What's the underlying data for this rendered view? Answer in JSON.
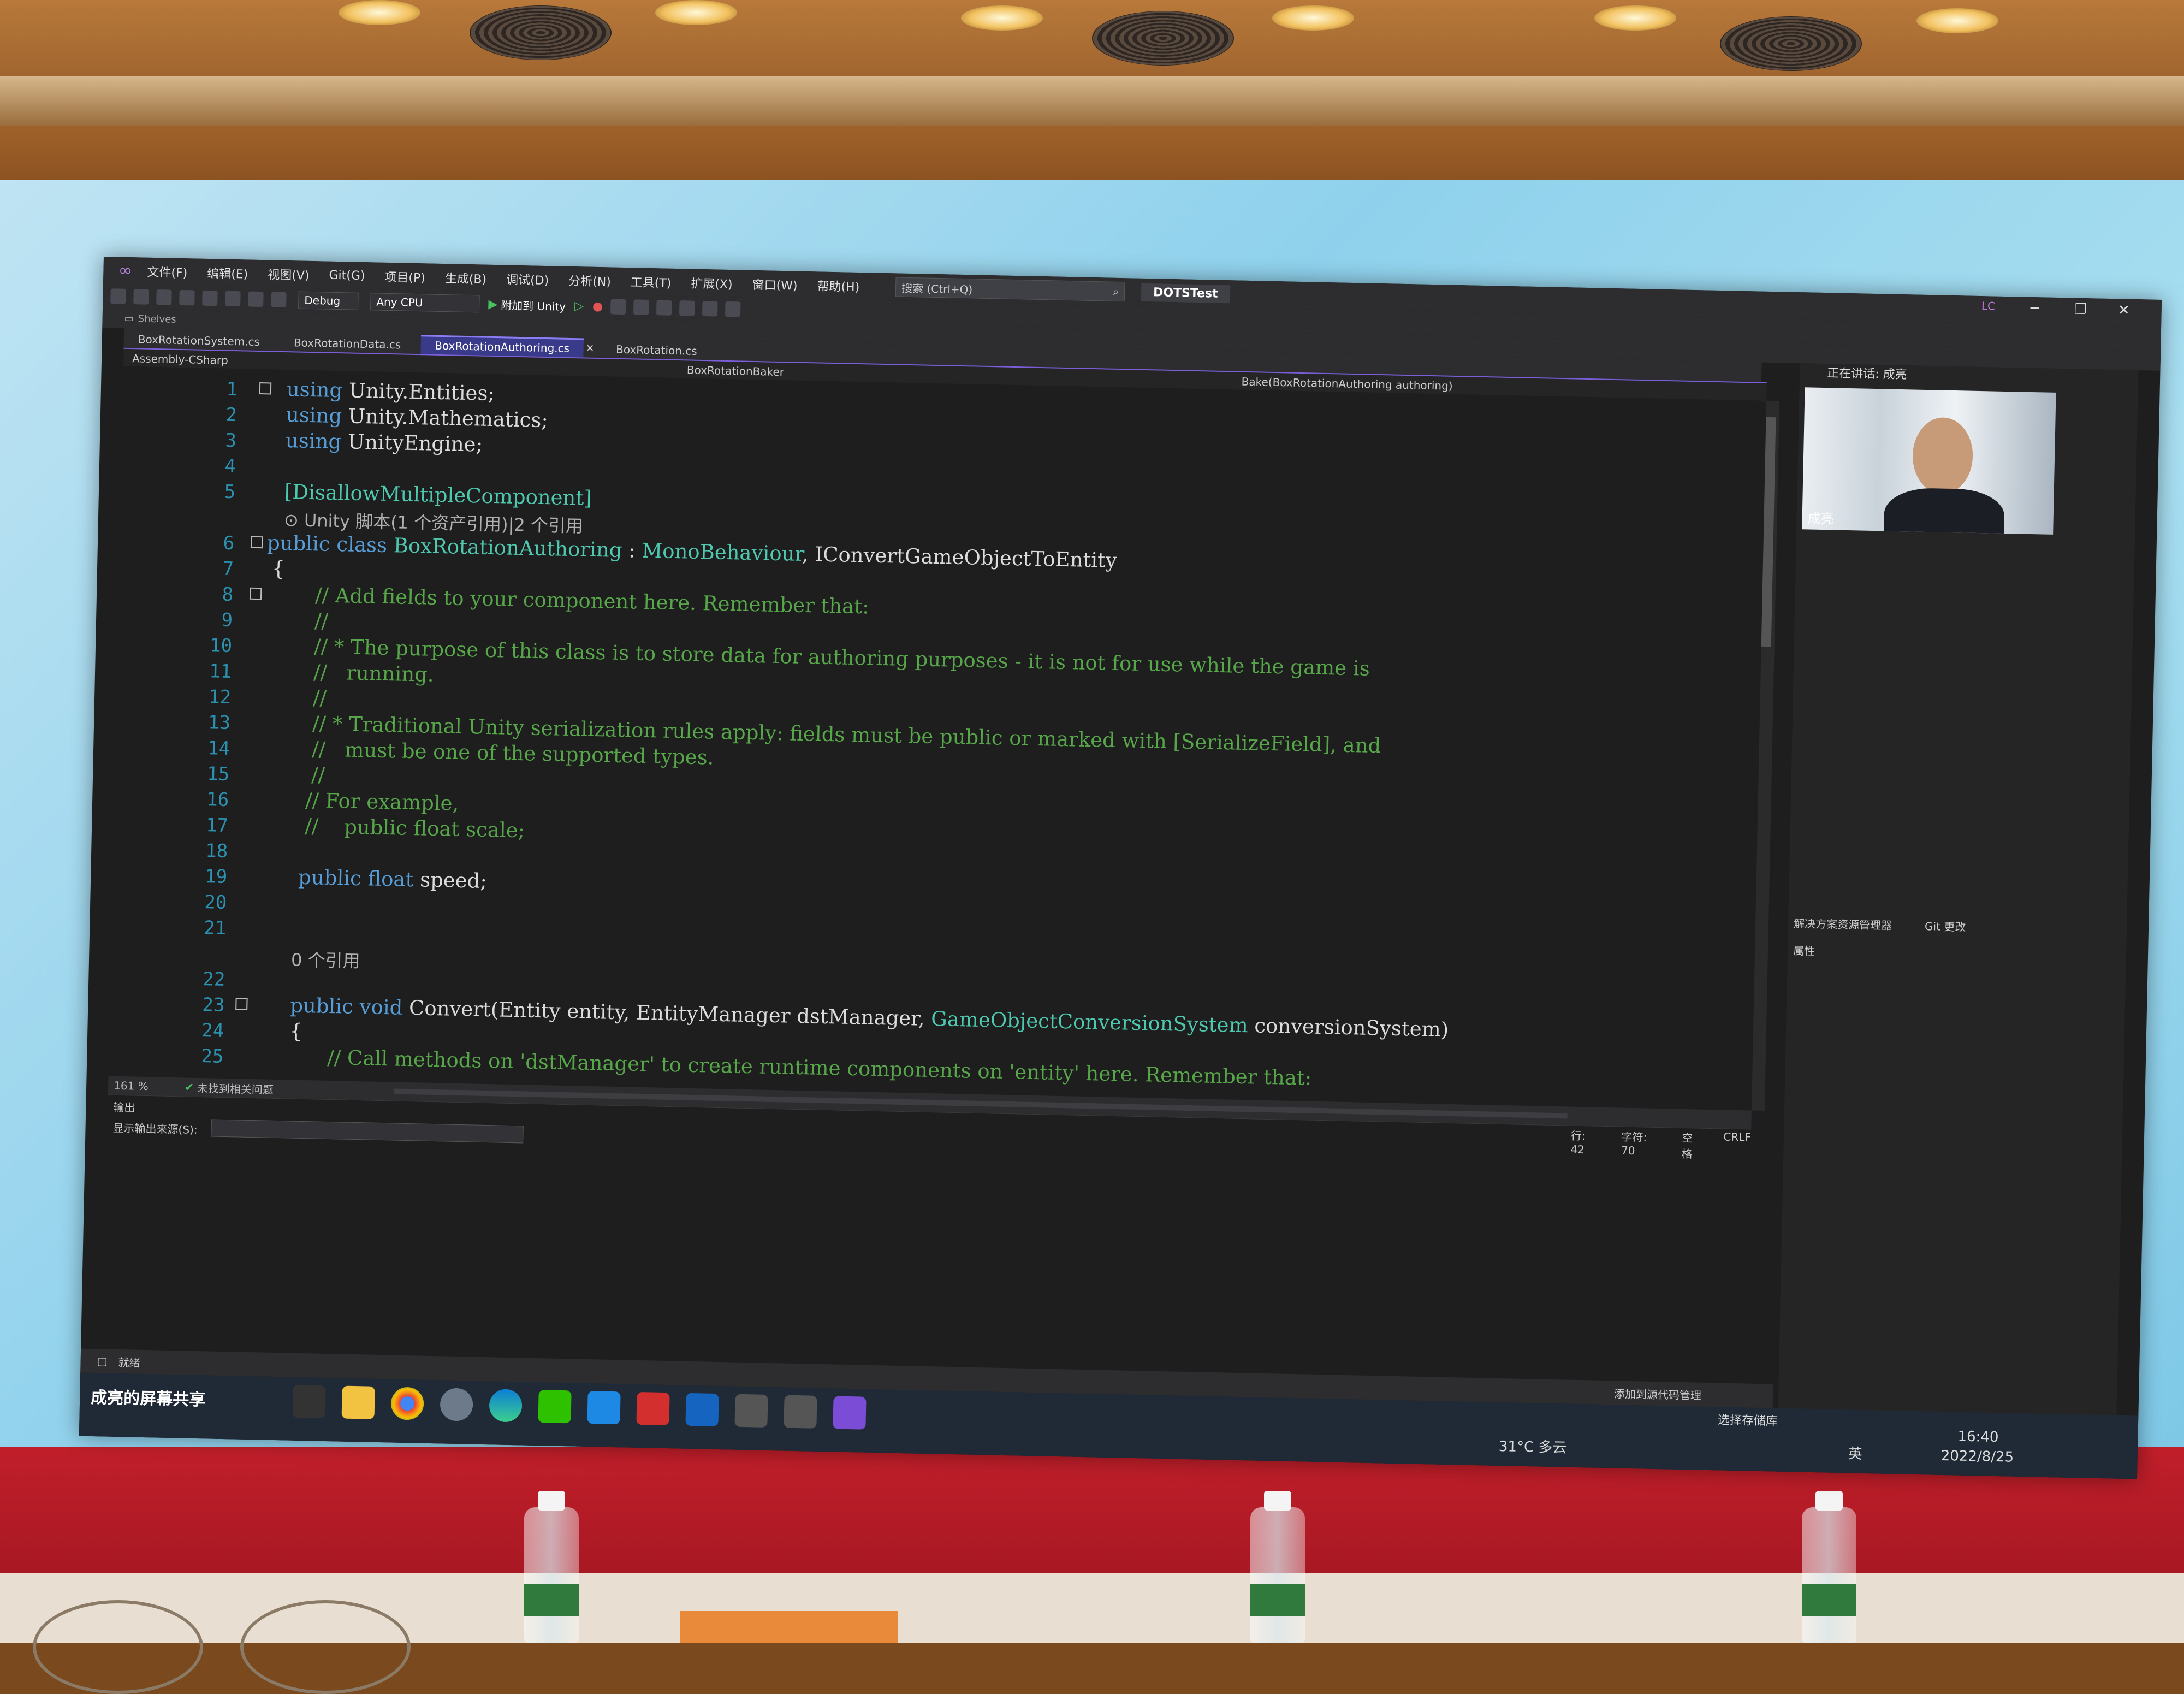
{
  "window": {
    "menu": [
      "文件(F)",
      "编辑(E)",
      "视图(V)",
      "Git(G)",
      "项目(P)",
      "生成(B)",
      "调试(D)",
      "分析(N)",
      "工具(T)",
      "扩展(X)",
      "窗口(W)",
      "帮助(H)"
    ],
    "search_placeholder": "搜索 (Ctrl+Q)",
    "project_name": "DOTSTest",
    "user_badge": "LC"
  },
  "toolbar": {
    "config": "Debug",
    "platform": "Any CPU",
    "run_label": "附加到 Unity",
    "shelves_label": "Shelves"
  },
  "tabs": [
    "BoxRotationSystem.cs",
    "BoxRotationData.cs",
    "BoxRotationAuthoring.cs",
    "BoxRotation.cs"
  ],
  "navbar": {
    "project": "Assembly-CSharp",
    "class": "BoxRotationBaker",
    "member": "Bake(BoxRotationAuthoring authoring)"
  },
  "code": {
    "line_numbers": [
      "1",
      "2",
      "3",
      "4",
      "5",
      "6",
      "7",
      "8",
      "9",
      "10",
      "11",
      "12",
      "13",
      "14",
      "15",
      "16",
      "17",
      "18",
      "19",
      "20",
      "21",
      "22",
      "23",
      "24",
      "25"
    ],
    "l1": [
      "using",
      " Unity.Entities;"
    ],
    "l2": [
      "using",
      " Unity.Mathematics;"
    ],
    "l3": [
      "using",
      " UnityEngine;"
    ],
    "l5": "[DisallowMultipleComponent]",
    "lens1": "⊙ Unity 脚本(1 个资产引用)|2 个引用",
    "l6": [
      "public class",
      " BoxRotationAuthoring",
      " : ",
      "MonoBehaviour",
      ", IConvertGameObjectToEntity"
    ],
    "l7": "{",
    "l8": "// Add fields to your component here. Remember that:",
    "l9": "//",
    "l10": "// * The purpose of this class is to store data for authoring purposes - it is not for use while the game is",
    "l11": "//   running.",
    "l12": "//",
    "l13": "// * Traditional Unity serialization rules apply: fields must be public or marked with [SerializeField], and",
    "l14": "//   must be one of the supported types.",
    "l15": "//",
    "l16": "// For example,",
    "l17": "//    public float scale;",
    "l19": [
      "public float",
      " speed;"
    ],
    "lens2": "0 个引用",
    "l22": [
      "public void",
      " Convert(Entity entity, EntityManager dstManager, ",
      "GameObjectConversionSystem",
      " conversionSystem)"
    ],
    "l23": "{",
    "l24": "// Call methods on 'dstManager' to create runtime components on 'entity' here. Remember that:",
    "l25": "//"
  },
  "status": {
    "zoom": "161 %",
    "issues": "未找到相关问题",
    "line": "行: 42",
    "char": "字符: 70",
    "spaces": "空格",
    "eol": "CRLF"
  },
  "output": {
    "title": "输出",
    "source_label": "显示输出来源(S):"
  },
  "right_pane": {
    "speaking": "正在讲话: 成亮",
    "video_name": "成亮",
    "tab_solution": "解决方案资源管理器",
    "tab_git": "Git 更改",
    "properties": "属性"
  },
  "bottom": {
    "ready": "就绪",
    "screen_share": "成亮的屏幕共享",
    "add_source": "添加到源代码管理",
    "select_repo": "选择存储库",
    "weather": "31°C 多云",
    "ime": "英",
    "time": "16:40",
    "date": "2022/8/25"
  }
}
